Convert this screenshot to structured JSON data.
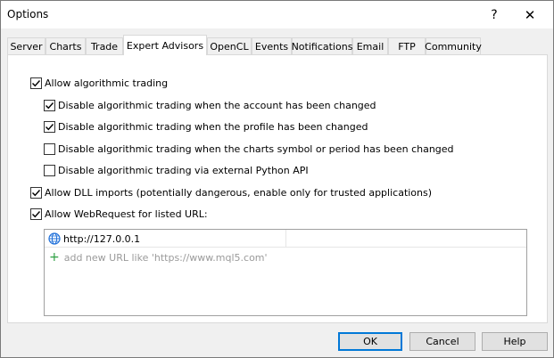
{
  "window": {
    "title": "Options",
    "help_glyph": "?",
    "close_glyph": "✕"
  },
  "tabs": [
    {
      "label": "Server"
    },
    {
      "label": "Charts"
    },
    {
      "label": "Trade"
    },
    {
      "label": "Expert Advisors",
      "active": true
    },
    {
      "label": "OpenCL"
    },
    {
      "label": "Events"
    },
    {
      "label": "Notifications"
    },
    {
      "label": "Email"
    },
    {
      "label": "FTP"
    },
    {
      "label": "Community"
    }
  ],
  "options": {
    "allow_algo": {
      "label": "Allow algorithmic trading",
      "checked": true
    },
    "disable_account": {
      "label": "Disable algorithmic trading when the account has been changed",
      "checked": true
    },
    "disable_profile": {
      "label": "Disable algorithmic trading when the profile has been changed",
      "checked": true
    },
    "disable_symbol": {
      "label": "Disable algorithmic trading when the charts symbol or period has been changed",
      "checked": false
    },
    "disable_python": {
      "label": "Disable algorithmic trading via external Python API",
      "checked": false
    },
    "allow_dll": {
      "label": "Allow DLL imports (potentially dangerous, enable only for trusted applications)",
      "checked": true
    },
    "allow_webrequest": {
      "label": "Allow WebRequest for listed URL:",
      "checked": true
    }
  },
  "url_list": {
    "urls": [
      "http://127.0.0.1"
    ],
    "add_placeholder": "add new URL like 'https://www.mql5.com'",
    "add_icon": "plus-icon",
    "url_icon": "globe-icon"
  },
  "buttons": {
    "ok": "OK",
    "cancel": "Cancel",
    "help": "Help"
  },
  "colors": {
    "accent": "#0078d7",
    "add_icon": "#2ea043",
    "globe": "#1e6fd9"
  }
}
